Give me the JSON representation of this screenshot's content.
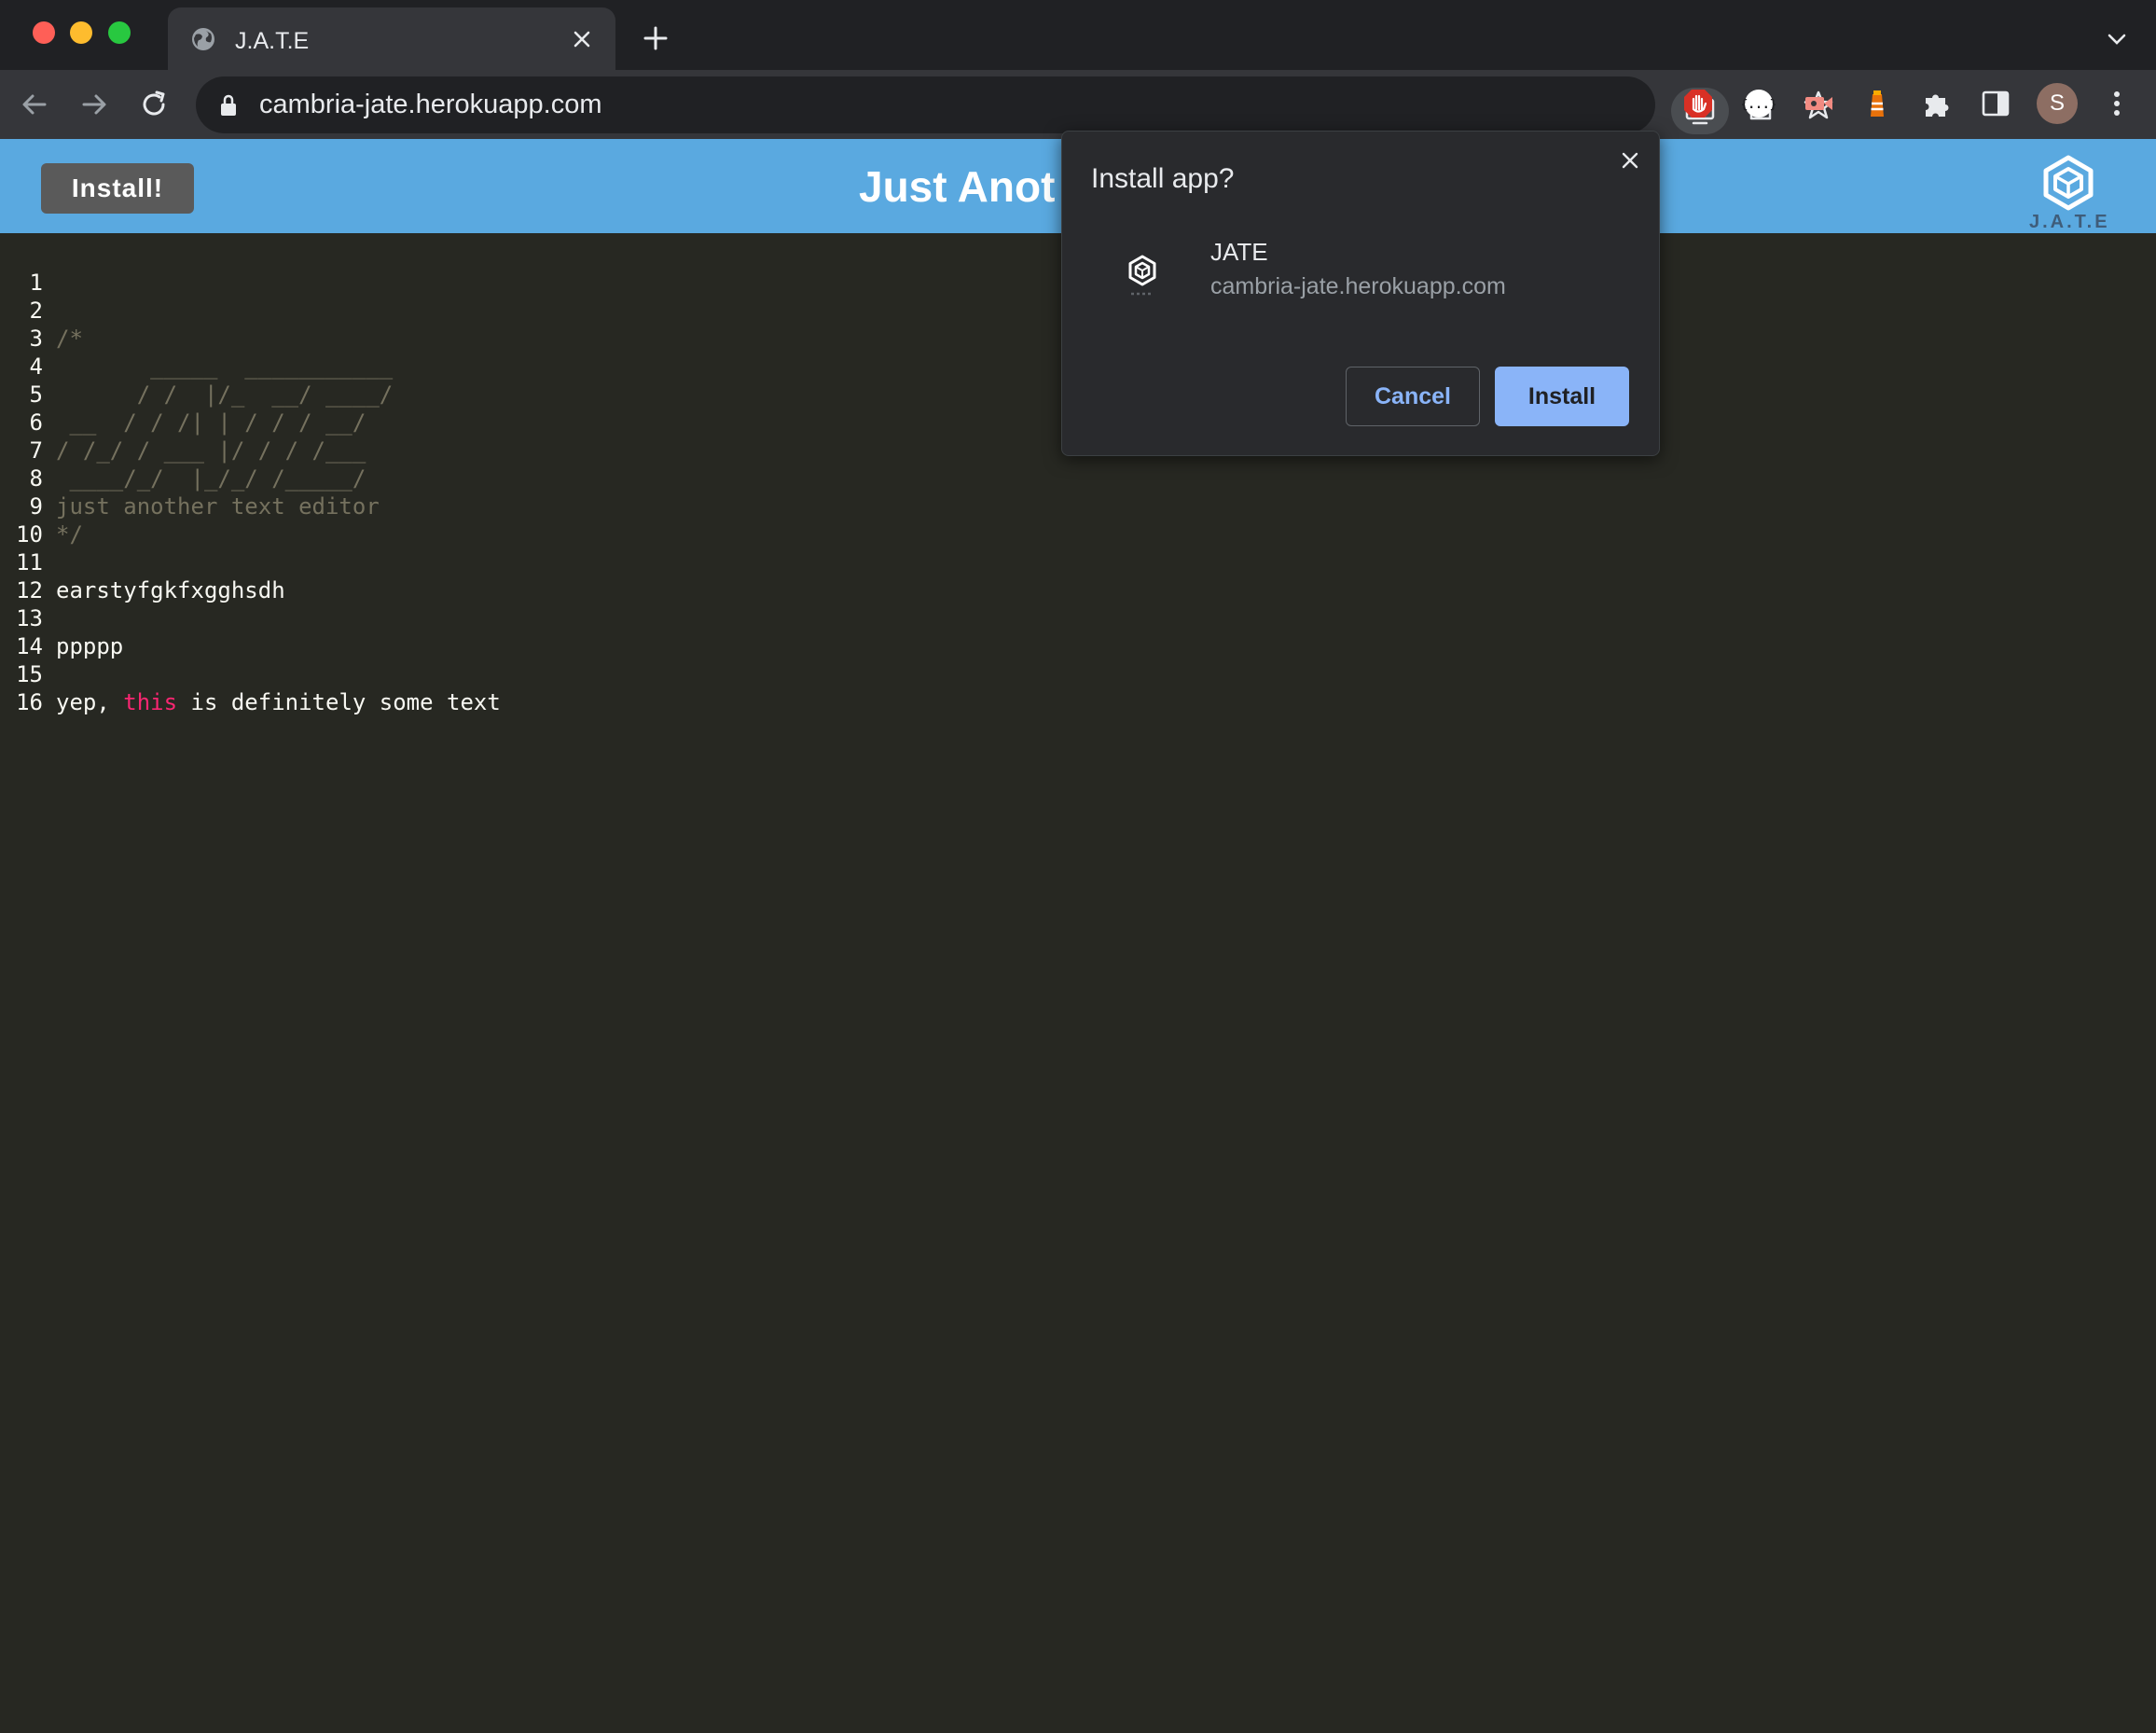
{
  "browser": {
    "tab_title": "J.A.T.E",
    "url": "cambria-jate.herokuapp.com",
    "profile_initial": "S"
  },
  "app": {
    "install_button": "Install!",
    "title": "Just Anot",
    "logo_text": "J.A.T.E"
  },
  "editor": {
    "lines": [
      {
        "n": "1",
        "text": ""
      },
      {
        "n": "2",
        "text": "/*"
      },
      {
        "n": "3",
        "text": "       _____  ___________"
      },
      {
        "n": "4",
        "text": "      / /  |/_  __/ ____/"
      },
      {
        "n": "5",
        "text": " __  / / /| | / / / __/"
      },
      {
        "n": "6",
        "text": "/ /_/ / ___ |/ / / /___"
      },
      {
        "n": "7",
        "text": " ____/_/  |_/_/ /_____/"
      },
      {
        "n": "8",
        "text": "just another text editor"
      },
      {
        "n": "9",
        "text": "*/"
      },
      {
        "n": "10",
        "text": ""
      },
      {
        "n": "11",
        "text": "earstyfgkfxgghsdh"
      },
      {
        "n": "12",
        "text": ""
      },
      {
        "n": "13",
        "text": "ppppp"
      },
      {
        "n": "14",
        "text": ""
      },
      {
        "n": "15",
        "text_before": "yep, ",
        "keyword": "this",
        "text_after": " is definitely some text"
      },
      {
        "n": "16",
        "text": ""
      }
    ]
  },
  "dialog": {
    "title": "Install app?",
    "app_name": "JATE",
    "app_url": "cambria-jate.herokuapp.com",
    "cancel_label": "Cancel",
    "install_label": "Install"
  }
}
